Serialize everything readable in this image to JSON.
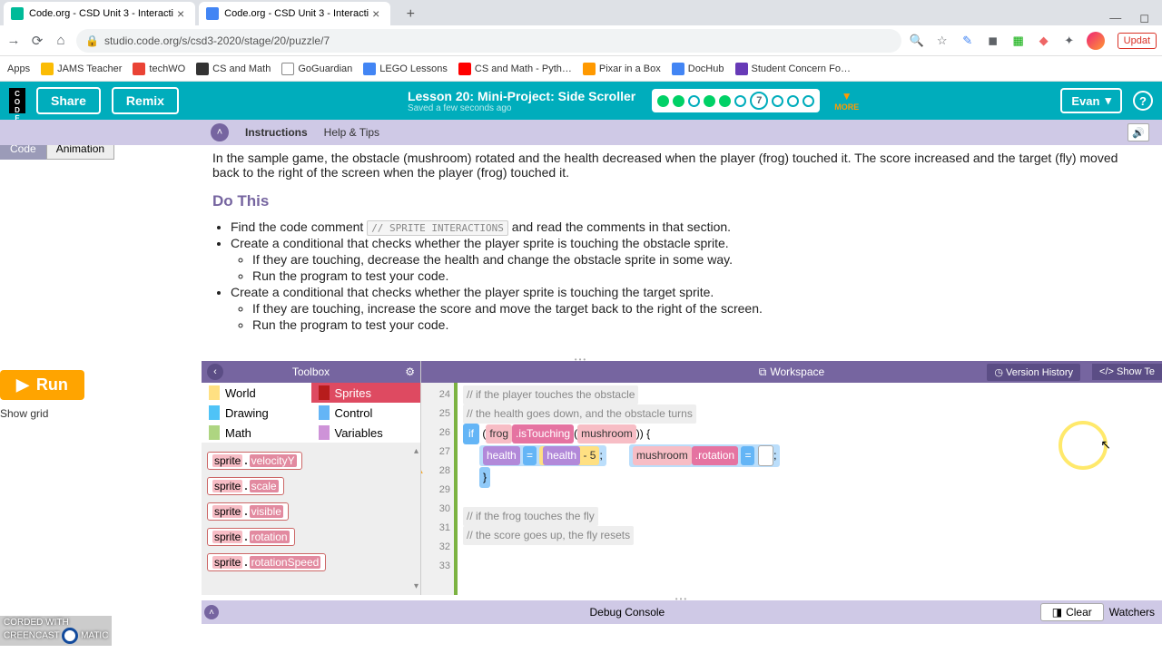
{
  "browser": {
    "tabs": [
      {
        "title": "Code.org - CSD Unit 3 - Interacti"
      },
      {
        "title": "Code.org - CSD Unit 3 - Interacti"
      }
    ],
    "url": "studio.code.org/s/csd3-2020/stage/20/puzzle/7",
    "update": "Updat",
    "bookmarks": [
      "Apps",
      "JAMS Teacher",
      "techWO",
      "CS and Math",
      "GoGuardian",
      "LEGO Lessons",
      "CS and Math - Pyth…",
      "Pixar in a Box",
      "DocHub",
      "Student Concern Fo…"
    ]
  },
  "app": {
    "share": "Share",
    "remix": "Remix",
    "lesson": "Lesson 20: Mini-Project: Side Scroller",
    "saved": "Saved a few seconds ago",
    "current": "7",
    "more": "MORE",
    "user": "Evan",
    "tabs": {
      "code": "Code",
      "anim": "Animation"
    },
    "row2": {
      "instr": "Instructions",
      "help": "Help & Tips"
    }
  },
  "instr": {
    "intro": "In the sample game, the obstacle (mushroom) rotated and the health decreased when the player (frog) touched it. The score increased and the target (fly) moved back to the right of the screen when the player (frog) touched it.",
    "do": "Do This",
    "b1": "Find the code comment ",
    "codecmt": "// SPRITE INTERACTIONS",
    "b1b": " and read the comments in that section.",
    "b2": "Create a conditional that checks whether the player sprite is touching the obstacle sprite.",
    "b2a": "If they are touching, decrease the health and change the obstacle sprite in some way.",
    "b2b": "Run the program to test your code.",
    "b3": "Create a conditional that checks whether the player sprite is touching the target sprite.",
    "b3a": "If they are touching, increase the score and move the target back to the right of the screen.",
    "b3b": "Run the program to test your code."
  },
  "run": {
    "btn": "Run",
    "grid": "Show grid"
  },
  "toolbox": {
    "title": "Toolbox",
    "cats": [
      "World",
      "Sprites",
      "Drawing",
      "Control",
      "Math",
      "Variables"
    ],
    "blocks": [
      "sprite.velocityY",
      "sprite.scale",
      "sprite.visible",
      "sprite.rotation",
      "sprite.rotationSpeed"
    ]
  },
  "ws": {
    "title": "Workspace",
    "vh": "Version History",
    "show": "Show Te",
    "lines": [
      "24",
      "25",
      "26",
      "27",
      "28",
      "29",
      "30",
      "31",
      "32",
      "33"
    ],
    "c24": "// if the player touches the obstacle",
    "c25": "// the health goes down, and the obstacle turns",
    "c31": "// if the frog touches the fly",
    "c32": "// the score goes up, the fly resets",
    "if": "if",
    "frog": "frog",
    "isT": ".isTouching",
    "mush": "mushroom",
    "health": "health",
    "eq": "=",
    "minus": "- 5",
    "rot": ".rotation"
  },
  "dbg": {
    "title": "Debug Console",
    "clear": "Clear",
    "watch": "Watchers"
  },
  "wm": {
    "a": "CORDED WITH",
    "b": "CREENCAST",
    "c": "MATIC"
  }
}
